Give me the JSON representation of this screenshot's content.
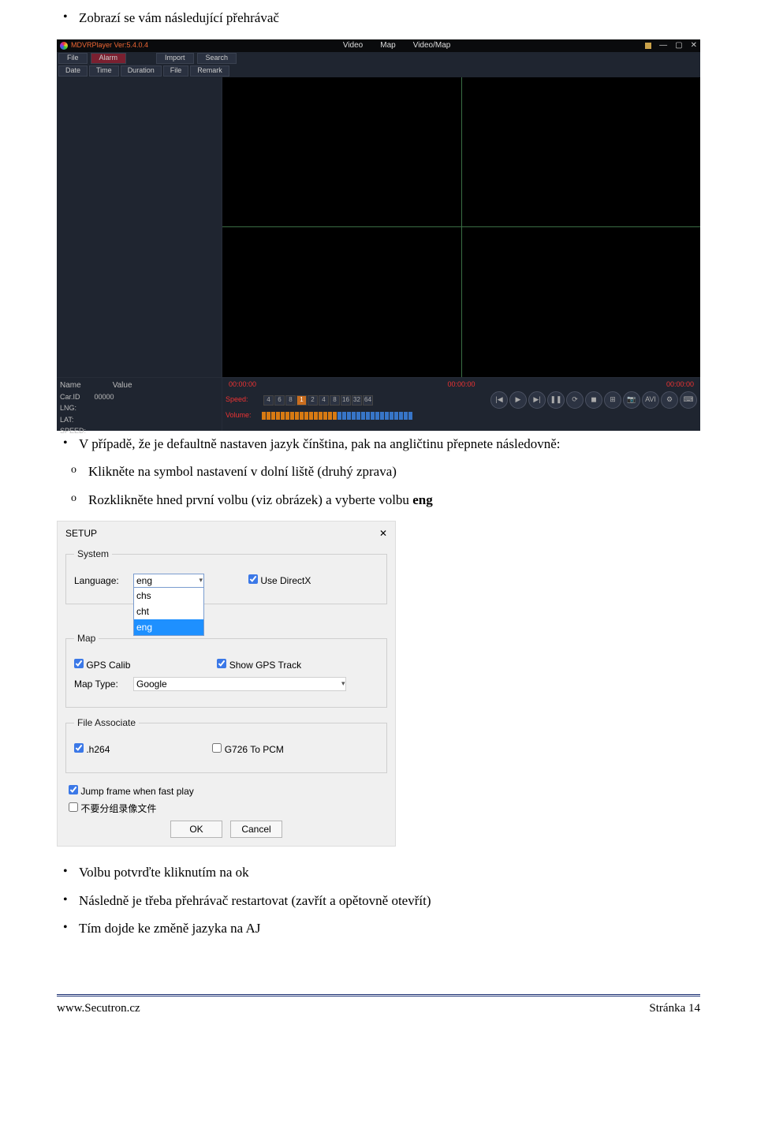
{
  "doc": {
    "bullets": {
      "intro": "Zobrazí se vám následující přehrávač",
      "lang": "V případě, že je defaultně nastaven jazyk čínština, pak na angličtinu přepnete následovně:",
      "sub1": "Klikněte na symbol nastavení v dolní liště (druhý zprava)",
      "sub2_prefix": "Rozklikněte hned první volbu (viz obrázek) a vyberte volbu ",
      "sub2_bold": "eng",
      "confirm": "Volbu potvrďte kliknutím na ok",
      "restart": "Následně je třeba přehrávač restartovat (zavřít a opětovně otevřít)",
      "result": "Tím dojde ke změně jazyka na AJ"
    },
    "footer_left": "www.Secutron.cz",
    "footer_right": "Stránka 14"
  },
  "player": {
    "title": "MDVRPlayer Ver:5.4.0.4",
    "top_tabs": [
      "Video",
      "Map",
      "Video/Map"
    ],
    "main_tabs": {
      "file": "File",
      "alarm": "Alarm"
    },
    "side_btns": [
      "Import",
      "Search"
    ],
    "cols": [
      "Date",
      "Time",
      "Duration",
      "File",
      "Remark"
    ],
    "info": {
      "name": "Name",
      "value": "Value",
      "carid_l": "Car.ID",
      "carid_v": "00000",
      "lng": "LNG:",
      "lat": "LAT:",
      "speed": "SPEED:"
    },
    "times": [
      "00:00:00",
      "00:00:00",
      "00:00:00"
    ],
    "speed_label": "Speed:",
    "volume_label": "Volume:",
    "speed_nums": [
      "4",
      "6",
      "8",
      "1",
      "2",
      "4",
      "8",
      "16",
      "32",
      "64"
    ],
    "round_labels": [
      "|◀",
      "▶",
      "▶|",
      "❚❚",
      "⟳",
      "◼",
      "⊞",
      "📷",
      "AVI",
      "⚙",
      "⌨"
    ]
  },
  "setup": {
    "title": "SETUP",
    "lang_label": "Language:",
    "lang_value": "eng",
    "lang_opts": [
      "chs",
      "cht",
      "eng"
    ],
    "use_dx": "Use DirectX",
    "gps_calib": "GPS Calib",
    "show_track": "Show GPS Track",
    "maptype_label": "Map Type:",
    "maptype_value": "Google",
    "h264": ".h264",
    "g726": "G726 To PCM",
    "jump": "Jump frame when fast play",
    "cn_opt": "不要分组录像文件",
    "legend_system": "System",
    "legend_map": "Map",
    "legend_file": "File Associate",
    "ok": "OK",
    "cancel": "Cancel"
  }
}
